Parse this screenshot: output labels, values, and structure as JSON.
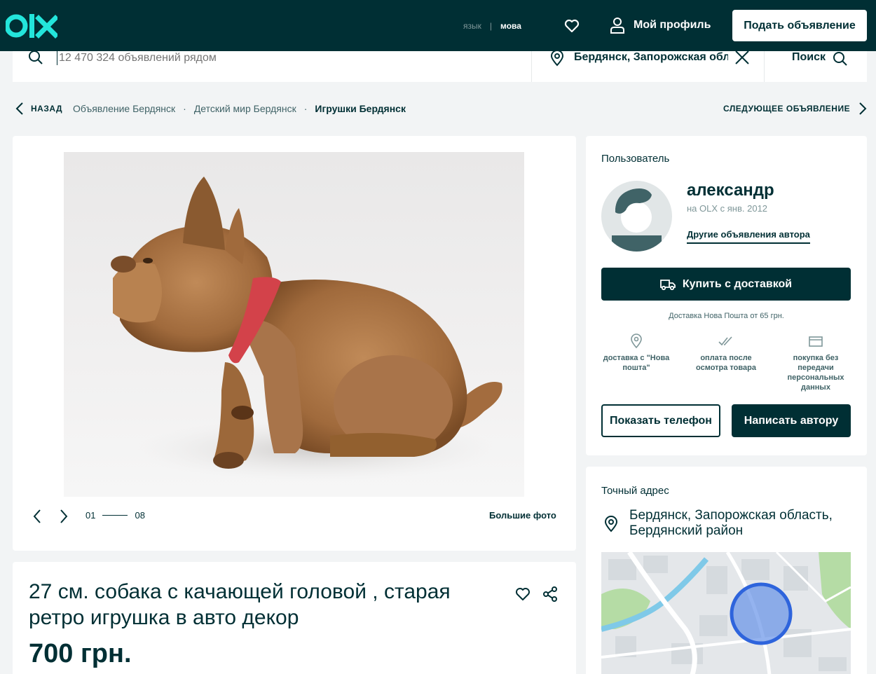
{
  "header": {
    "lang_ru": "язык",
    "lang_sep": "|",
    "lang_ua": "мова",
    "profile_label": "Мой профиль",
    "post_ad_label": "Подать объявление",
    "logo_text": "olx",
    "bg_color": "#002f34",
    "accent_color": "#23e5db"
  },
  "search": {
    "placeholder": "12 470 324 объявлений рядом",
    "location": "Бердянск, Запорожская обла",
    "submit_label": "Поиск"
  },
  "breadcrumbs": {
    "back_label": "НАЗАД",
    "items": [
      "Объявление Бердянск",
      "Детский мир Бердянск",
      "Игрушки Бердянск"
    ],
    "next_label": "СЛЕДУЮЩЕЕ ОБЪЯВЛЕНИЕ"
  },
  "gallery": {
    "current": "01",
    "total": "08",
    "big_photo_label": "Большие фото"
  },
  "listing": {
    "title": "27 см. собака с качающей головой , старая ретро игрушка в авто декор",
    "price": "700 грн."
  },
  "seller": {
    "section_label": "Пользователь",
    "name": "александр",
    "since": "на OLX с янв. 2012",
    "other_ads_label": "Другие объявления автора",
    "buy_label": "Купить с доставкой",
    "delivery_note": "Доставка Нова Пошта от 65 грн.",
    "features": [
      {
        "icon": "location-pin-icon",
        "label": "доставка с \"Нова пошта\""
      },
      {
        "icon": "double-check-icon",
        "label": "оплата после осмотра товара"
      },
      {
        "icon": "credit-card-icon",
        "label": "покупка без передачи персональных данных"
      }
    ],
    "show_phone_label": "Показать телефон",
    "message_label": "Написать автору"
  },
  "address": {
    "section_label": "Точный адрес",
    "text": "Бердянск, Запорожская область, Бердянский район"
  }
}
